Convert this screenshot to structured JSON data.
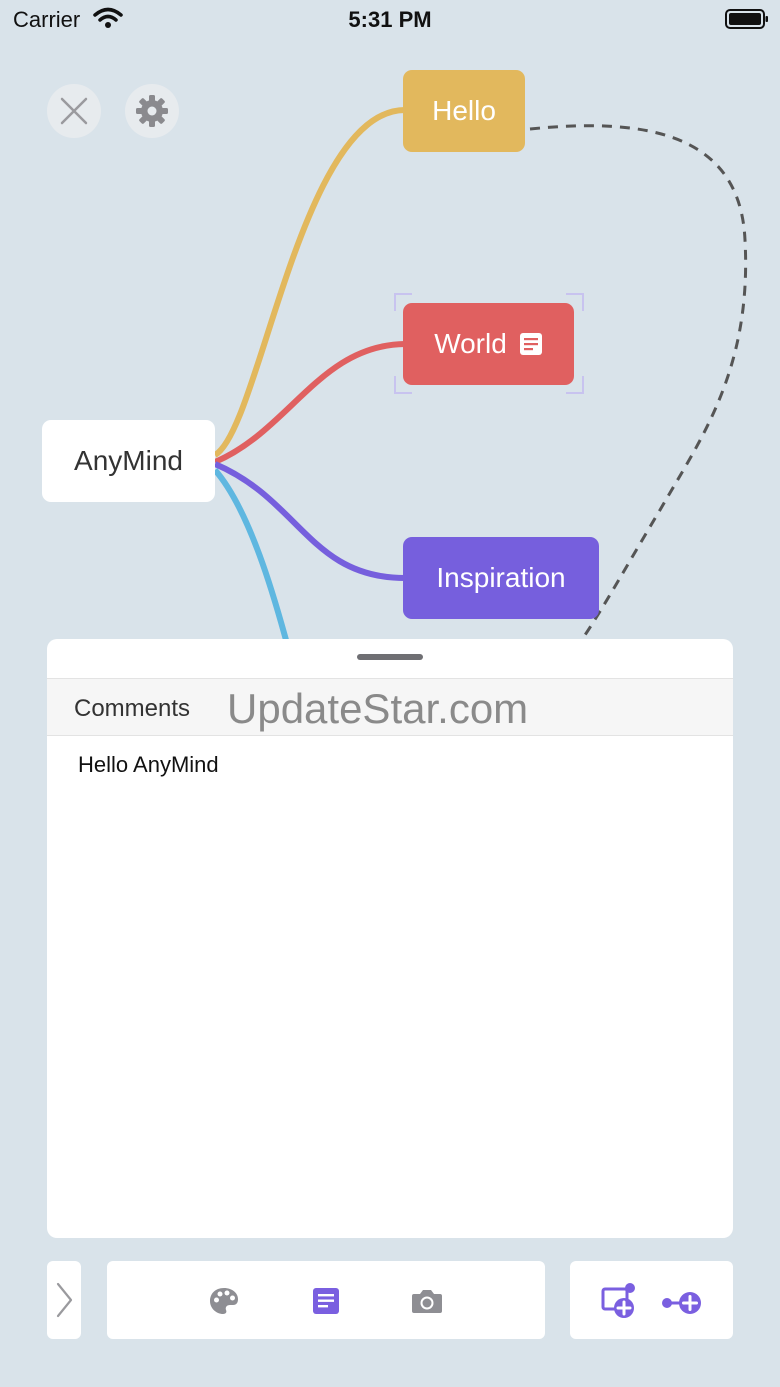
{
  "status_bar": {
    "carrier": "Carrier",
    "time": "5:31 PM"
  },
  "mindmap": {
    "root": "AnyMind",
    "nodes": [
      {
        "label": "Hello",
        "color": "#e2b85d"
      },
      {
        "label": "World",
        "color": "#e06060",
        "has_note": true,
        "selected": true
      },
      {
        "label": "Inspiration",
        "color": "#765fdd"
      }
    ],
    "hidden_branch_color": "#5fb7e0",
    "relation_line_color": "#555555"
  },
  "comments_panel": {
    "title": "Comments",
    "watermark": "UpdateStar.com",
    "text": "Hello AnyMind"
  },
  "toolbar": {
    "icons": [
      "chevron-right-icon",
      "palette-icon",
      "note-icon",
      "camera-icon",
      "add-child-node-icon",
      "add-sibling-node-icon"
    ],
    "accent_color": "#7a5fe0",
    "muted_color": "#8e8e93"
  }
}
